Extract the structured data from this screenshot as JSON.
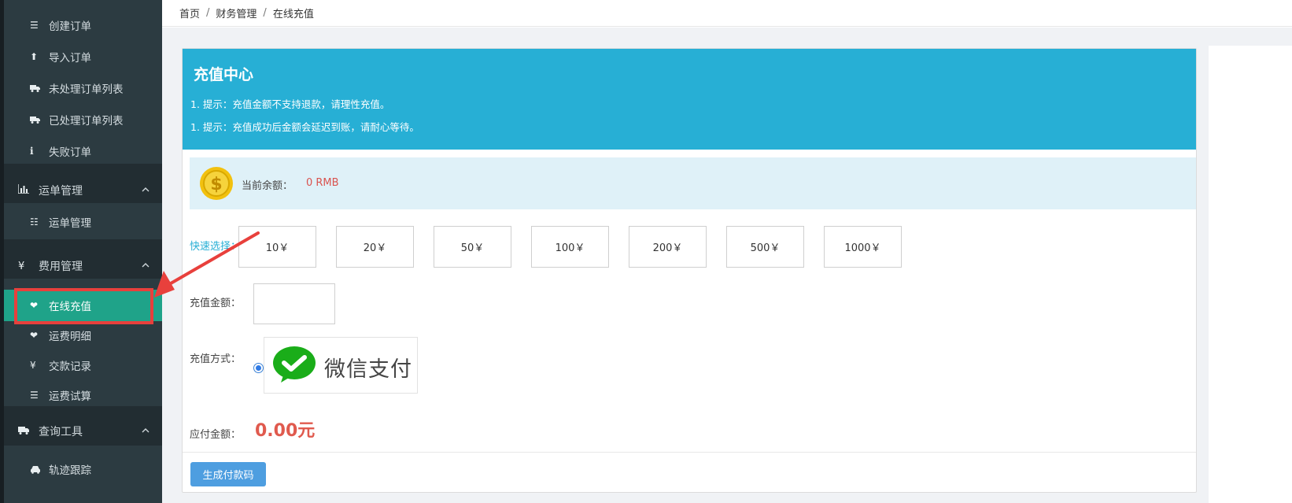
{
  "sidebar": {
    "items_top": [
      {
        "label": "创建订单",
        "icon": "list-icon"
      },
      {
        "label": "导入订单",
        "icon": "upload-icon"
      },
      {
        "label": "未处理订单列表",
        "icon": "truck-icon"
      },
      {
        "label": "已处理订单列表",
        "icon": "truck-icon"
      },
      {
        "label": "失败订单",
        "icon": "info-icon"
      }
    ],
    "group_waybill": {
      "label": "运单管理",
      "icon": "bar-chart-icon"
    },
    "waybill_item": {
      "label": "运单管理",
      "icon": "table-icon"
    },
    "group_fee": {
      "label": "费用管理",
      "icon": "yen-icon"
    },
    "fee_items": [
      {
        "label": "在线充值",
        "icon": "heart-icon"
      },
      {
        "label": "运费明细",
        "icon": "heart-icon"
      },
      {
        "label": "交款记录",
        "icon": "yen-icon"
      },
      {
        "label": "运费试算",
        "icon": "list-icon"
      }
    ],
    "group_query": {
      "label": "查询工具",
      "icon": "truck-icon"
    },
    "query_item": {
      "label": "轨迹跟踪",
      "icon": "car-icon"
    }
  },
  "breadcrumb": {
    "home": "首页",
    "section": "财务管理",
    "current": "在线充值",
    "separator": "/"
  },
  "card": {
    "title": "充值中心",
    "tip1": "1. 提示：充值金额不支持退款，请理性充值。",
    "tip2": "1. 提示：充值成功后金额会延迟到账，请耐心等待。"
  },
  "balance": {
    "label": "当前余额：",
    "value": "0 RMB"
  },
  "quick": {
    "label": "快速选择：",
    "amounts": [
      "10￥",
      "20￥",
      "50￥",
      "100￥",
      "200￥",
      "500￥",
      "1000￥"
    ]
  },
  "amount_field": {
    "label": "充值金额：",
    "value": ""
  },
  "method": {
    "label": "充值方式：",
    "option": "微信支付"
  },
  "payable": {
    "label": "应付金额：",
    "value": "0.00元"
  },
  "generate_button": "生成付款码",
  "colors": {
    "sidebar_bg": "#222d32",
    "active": "#1fa389",
    "header": "#27afd5",
    "highlight": "#e8403c",
    "button": "#4e9ee0"
  }
}
